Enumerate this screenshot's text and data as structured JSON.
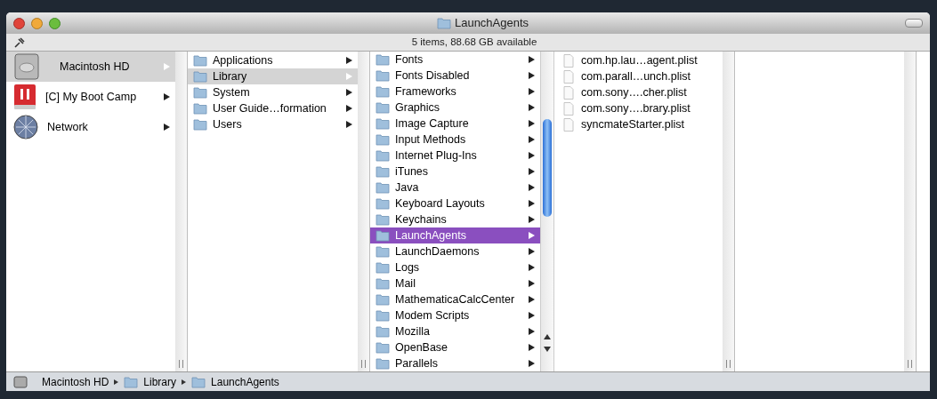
{
  "window": {
    "title": "LaunchAgents"
  },
  "status": "5 items, 88.68 GB available",
  "sidebar": [
    {
      "label": "Macintosh HD",
      "kind": "disk",
      "selected": true
    },
    {
      "label": "[C] My Boot Camp",
      "kind": "bootcamp",
      "selected": false
    },
    {
      "label": "Network",
      "kind": "network",
      "selected": false
    }
  ],
  "column_2": [
    {
      "label": "Applications",
      "selected": false
    },
    {
      "label": "Library",
      "selected": true
    },
    {
      "label": "System",
      "selected": false
    },
    {
      "label": "User Guide…formation",
      "selected": false
    },
    {
      "label": "Users",
      "selected": false
    }
  ],
  "column_3": [
    {
      "label": "Fonts",
      "selected": false
    },
    {
      "label": "Fonts Disabled",
      "selected": false
    },
    {
      "label": "Frameworks",
      "selected": false
    },
    {
      "label": "Graphics",
      "selected": false
    },
    {
      "label": "Image Capture",
      "selected": false
    },
    {
      "label": "Input Methods",
      "selected": false
    },
    {
      "label": "Internet Plug-Ins",
      "selected": false
    },
    {
      "label": "iTunes",
      "selected": false
    },
    {
      "label": "Java",
      "selected": false
    },
    {
      "label": "Keyboard Layouts",
      "selected": false
    },
    {
      "label": "Keychains",
      "selected": false
    },
    {
      "label": "LaunchAgents",
      "selected": true
    },
    {
      "label": "LaunchDaemons",
      "selected": false
    },
    {
      "label": "Logs",
      "selected": false
    },
    {
      "label": "Mail",
      "selected": false
    },
    {
      "label": "MathematicaCalcCenter",
      "selected": false
    },
    {
      "label": "Modem Scripts",
      "selected": false
    },
    {
      "label": "Mozilla",
      "selected": false
    },
    {
      "label": "OpenBase",
      "selected": false
    },
    {
      "label": "Parallels",
      "selected": false
    }
  ],
  "column_4": [
    {
      "label": "com.hp.lau…agent.plist"
    },
    {
      "label": "com.parall…unch.plist"
    },
    {
      "label": "com.sony….cher.plist"
    },
    {
      "label": "com.sony….brary.plist"
    },
    {
      "label": "syncmateStarter.plist"
    }
  ],
  "path_bar": [
    "Macintosh HD",
    "Library",
    "LaunchAgents"
  ]
}
